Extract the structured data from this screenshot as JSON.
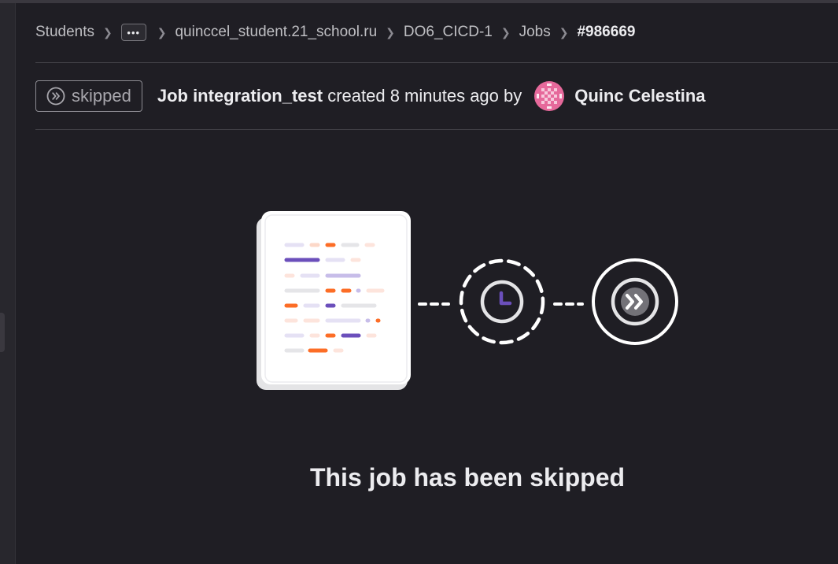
{
  "breadcrumb": {
    "items": [
      "Students",
      "quinccel_student.21_school.ru",
      "DO6_CICD-1",
      "Jobs"
    ],
    "more_label": "•••",
    "current": "#986669"
  },
  "job_header": {
    "status": "skipped",
    "job_prefix": "Job integration_test",
    "created_text": " created 8 minutes ago by",
    "author": "Quinc Celestina"
  },
  "empty_state": {
    "title": "This job has been skipped"
  },
  "icons": {
    "status": "skipped-icon",
    "avatar": "user-avatar",
    "illustration": "skipped-job-illustration"
  },
  "colors": {
    "background": "#1f1e24",
    "text": "#ececef",
    "muted": "#bfbfc3",
    "accent_purple": "#6b4fbb",
    "accent_orange": "#fc6d26",
    "avatar_pink": "#e6699b"
  }
}
